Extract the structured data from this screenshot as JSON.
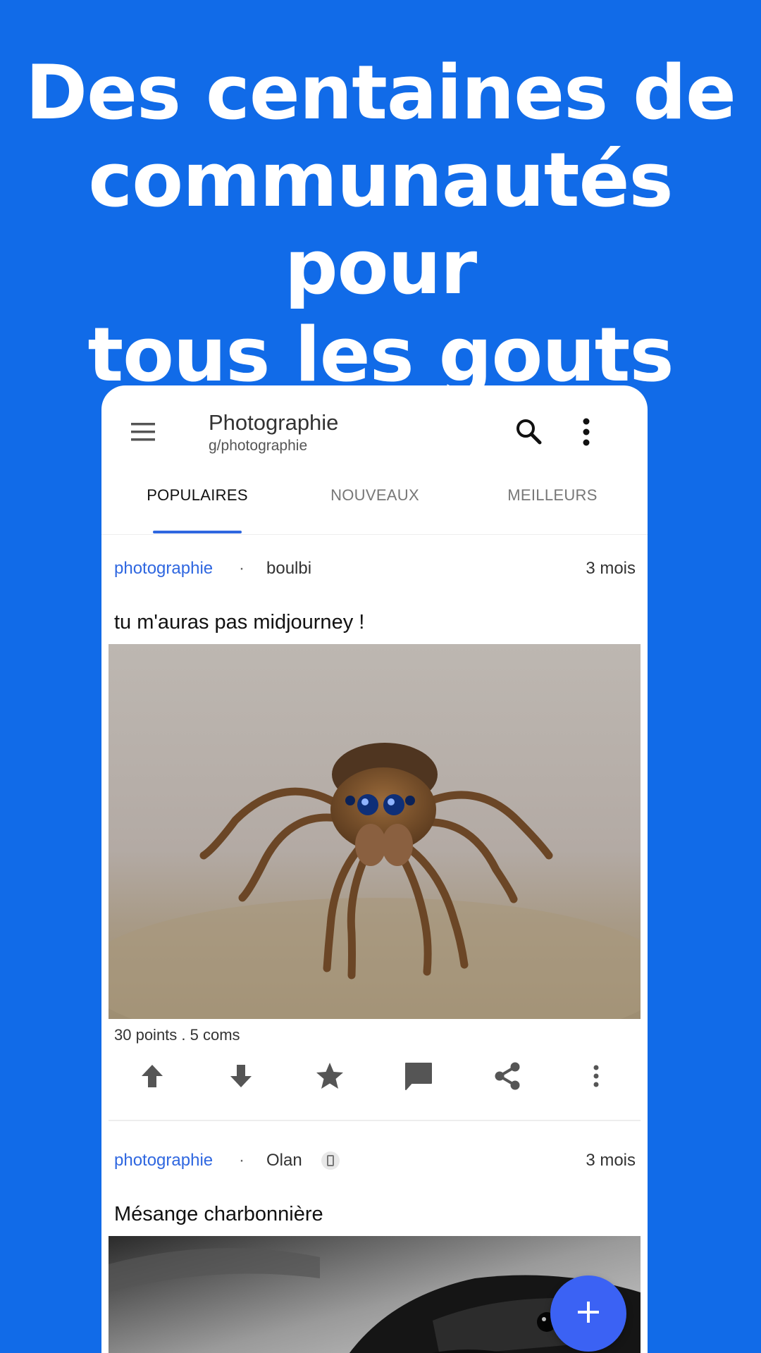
{
  "headline": {
    "line1": "Des centaines de",
    "line2": "communautés pour",
    "line3": "tous les gouts"
  },
  "appbar": {
    "title": "Photographie",
    "subtitle": "g/photographie",
    "icons": [
      "menu-icon",
      "search-icon",
      "more-vert-icon"
    ]
  },
  "tabs": [
    {
      "label": "POPULAIRES",
      "active": true
    },
    {
      "label": "NOUVEAUX",
      "active": false
    },
    {
      "label": "MEILLEURS",
      "active": false
    }
  ],
  "posts": [
    {
      "community": "photographie",
      "separator": "·",
      "author": "boulbi",
      "age": "3 mois",
      "title": "tu m'auras pas midjourney !",
      "image": "jumping-spider-photo",
      "stats": "30 points  .  5 coms",
      "actions": [
        "upvote-icon",
        "downvote-icon",
        "star-icon",
        "comment-icon",
        "share-icon",
        "more-vert-icon"
      ]
    },
    {
      "community": "photographie",
      "separator": "·",
      "author": "Olan",
      "author_badge": "mobile-device-icon",
      "age": "3 mois",
      "title": "Mésange charbonnière",
      "image": "great-tit-bird-photo"
    }
  ],
  "fab": {
    "icon": "plus-icon"
  },
  "colors": {
    "background": "#116be8",
    "accent": "#2f67e0",
    "fab": "#3b62f4"
  }
}
